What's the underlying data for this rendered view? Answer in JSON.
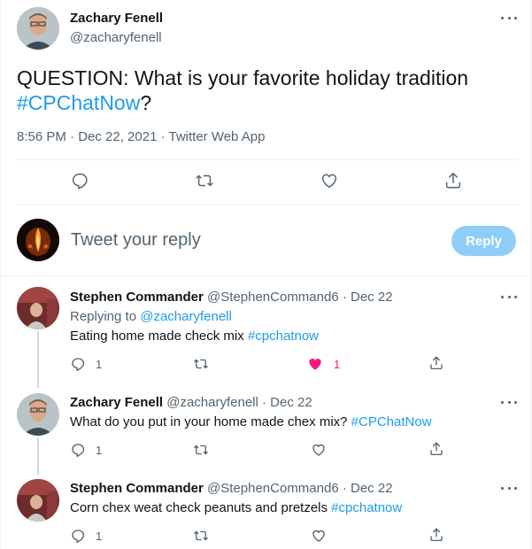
{
  "main_tweet": {
    "author_name": "Zachary Fenell",
    "author_handle": "@zacharyfenell",
    "text_plain": "QUESTION: What is your favorite holiday tradition ",
    "hashtag": "#CPChatNow",
    "text_end": "?",
    "meta": "8:56 PM · Dec 22, 2021 · Twitter Web App"
  },
  "reply_box": {
    "placeholder": "Tweet your reply",
    "button_label": "Reply"
  },
  "replies": [
    {
      "author_name": "Stephen Commander",
      "handle_time": "@StephenCommand6 · Dec 22",
      "replying_prefix": "Replying to ",
      "replying_to": "@zacharyfenell",
      "text_plain": "Eating home made check mix ",
      "hashtag": "#cpchatnow",
      "reply_count": "1",
      "like_count": "1"
    },
    {
      "author_name": "Zachary Fenell",
      "handle_time": "@zacharyfenell · Dec 22",
      "text_plain": "What do you put in your home made chex mix? ",
      "hashtag": "#CPChatNow",
      "reply_count": "1"
    },
    {
      "author_name": "Stephen Commander",
      "handle_time": "@StephenCommand6 · Dec 22",
      "text_plain": "Corn chex weat check peanuts and pretzels ",
      "hashtag": "#cpchatnow",
      "reply_count": "1"
    }
  ],
  "colors": {
    "accent": "#1d9bf0",
    "like_active": "#f91880",
    "reply_button_disabled": "#8ecdf8"
  },
  "icons": [
    "more-icon",
    "reply-icon",
    "retweet-icon",
    "like-icon",
    "share-icon"
  ]
}
